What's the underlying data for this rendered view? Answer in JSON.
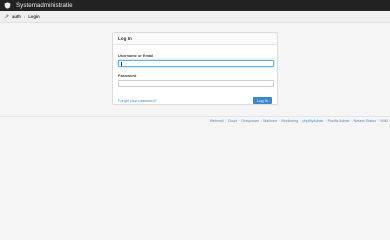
{
  "topbar": {
    "brand": "Systemadministratie",
    "logo_icon": "shield-icon"
  },
  "breadcrumb": {
    "icon": "wrench-icon",
    "items": [
      "auth",
      "Login"
    ],
    "separator": "›"
  },
  "login": {
    "heading": "Log In",
    "username_label": "Username or Email",
    "username_value": "",
    "password_label": "Password",
    "password_value": "",
    "forgot_link": "Forgot your password?",
    "submit_label": "Log In"
  },
  "footer": {
    "links": [
      "Webmail",
      "Cloud",
      "Groupware",
      "Mailmerr",
      "Monitoring",
      "phpMyAdmin",
      "Postfix Admin",
      "Netaxs Status",
      "WIKI"
    ]
  },
  "colors": {
    "topbar": "#222222",
    "accent": "#3a87c9",
    "link": "#428bca"
  }
}
